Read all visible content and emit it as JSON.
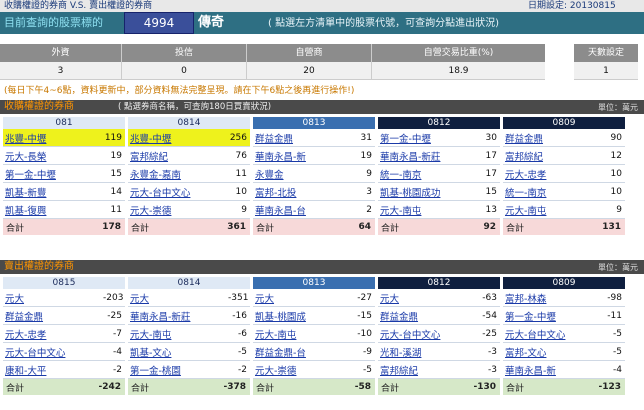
{
  "banner": {
    "title": "收購權證的券商 V.S. 賣出權證的券商",
    "date": "日期設定: 20130815"
  },
  "query": {
    "label": "目前查詢的股票標的",
    "code": "4994",
    "name": "傳奇",
    "hint": "( 點選左方清單中的股票代號，可查詢分點進出狀況)"
  },
  "summary": {
    "headers": [
      "外資",
      "投信",
      "自營商",
      "自營交易比重(%)"
    ],
    "values": [
      "3",
      "0",
      "20",
      "18.9"
    ],
    "days_label": "天數設定",
    "days_value": "1"
  },
  "note": "(每日下午4~6點，資料更新中，部分資料無法完整呈現。請在下午6點之後再進行操作!)",
  "buy": {
    "title": "收購權證的券商",
    "hint": "( 點選券商名稱，可查詢180日買賣狀況)",
    "unit": "單位：萬元",
    "columns": [
      {
        "date": "081",
        "total_label": "合計",
        "total": "178",
        "rows": [
          {
            "name": "兆豐-中壢",
            "value": "119"
          },
          {
            "name": "元大-長榮",
            "value": "19"
          },
          {
            "name": "第一金-中壢",
            "value": "15"
          },
          {
            "name": "凱基-新豐",
            "value": "14"
          },
          {
            "name": "凱基-復興",
            "value": "11"
          }
        ]
      },
      {
        "date": "0814",
        "total_label": "合計",
        "total": "361",
        "rows": [
          {
            "name": "兆豐-中壢",
            "value": "256"
          },
          {
            "name": "富邦綜紀",
            "value": "76"
          },
          {
            "name": "永豐金-嘉南",
            "value": "11"
          },
          {
            "name": "元大-台中文心",
            "value": "10"
          },
          {
            "name": "元大-崇德",
            "value": "9"
          }
        ]
      },
      {
        "date": "0813",
        "total_label": "合計",
        "total": "64",
        "rows": [
          {
            "name": "群益金鼎",
            "value": "31"
          },
          {
            "name": "華南永昌-新",
            "value": "19"
          },
          {
            "name": "永豐金",
            "value": "9"
          },
          {
            "name": "富邦-北投",
            "value": "3"
          },
          {
            "name": "華南永昌-台",
            "value": "2"
          }
        ]
      },
      {
        "date": "0812",
        "total_label": "合計",
        "total": "92",
        "rows": [
          {
            "name": "第一金-中壢",
            "value": "30"
          },
          {
            "name": "華南永昌-新莊",
            "value": "17"
          },
          {
            "name": "統一-南京",
            "value": "17"
          },
          {
            "name": "凱基-桃園成功",
            "value": "15"
          },
          {
            "name": "元大-南屯",
            "value": "13"
          }
        ]
      },
      {
        "date": "0809",
        "total_label": "合計",
        "total": "131",
        "rows": [
          {
            "name": "群益金鼎",
            "value": "90"
          },
          {
            "name": "富邦綜紀",
            "value": "12"
          },
          {
            "name": "元大-忠孝",
            "value": "10"
          },
          {
            "name": "統一-南京",
            "value": "10"
          },
          {
            "name": "元大-南屯",
            "value": "9"
          }
        ]
      }
    ]
  },
  "sell": {
    "title": "賣出權證的券商",
    "unit": "單位：萬元",
    "columns": [
      {
        "date": "0815",
        "total_label": "合計",
        "total": "-242",
        "rows": [
          {
            "name": "元大",
            "value": "-203"
          },
          {
            "name": "群益金鼎",
            "value": "-25"
          },
          {
            "name": "元大-忠孝",
            "value": "-7"
          },
          {
            "name": "元大-台中文心",
            "value": "-4"
          },
          {
            "name": "康和-大平",
            "value": "-2"
          }
        ]
      },
      {
        "date": "0814",
        "total_label": "合計",
        "total": "-378",
        "rows": [
          {
            "name": "元大",
            "value": "-351"
          },
          {
            "name": "華南永昌-新莊",
            "value": "-16"
          },
          {
            "name": "元大-南屯",
            "value": "-6"
          },
          {
            "name": "凱基-文心",
            "value": "-5"
          },
          {
            "name": "第一金-桃園",
            "value": "-2"
          }
        ]
      },
      {
        "date": "0813",
        "total_label": "合計",
        "total": "-58",
        "rows": [
          {
            "name": "元大",
            "value": "-27"
          },
          {
            "name": "凱基-桃園成",
            "value": "-15"
          },
          {
            "name": "元大-南屯",
            "value": "-10"
          },
          {
            "name": "群益金鼎-台",
            "value": "-9"
          },
          {
            "name": "元大-崇德",
            "value": "-5"
          }
        ]
      },
      {
        "date": "0812",
        "total_label": "合計",
        "total": "-130",
        "rows": [
          {
            "name": "元大",
            "value": "-63"
          },
          {
            "name": "群益金鼎",
            "value": "-54"
          },
          {
            "name": "元大-台中文心",
            "value": "-25"
          },
          {
            "name": "光和-溪湖",
            "value": "-3"
          },
          {
            "name": "富邦綜紀",
            "value": "-3"
          }
        ]
      },
      {
        "date": "0809",
        "total_label": "合計",
        "total": "-123",
        "rows": [
          {
            "name": "富邦-林森",
            "value": "-98"
          },
          {
            "name": "第一金-中壢",
            "value": "-11"
          },
          {
            "name": "元大-台中文心",
            "value": "-5"
          },
          {
            "name": "富邦-文心",
            "value": "-5"
          },
          {
            "name": "華南永昌-新",
            "value": "-4"
          }
        ]
      }
    ]
  },
  "colors": {
    "head_dark": "#0f1f3f",
    "head_mid": "#3a6fb0",
    "head_light": "#7fb0e0",
    "highlight": "#eef21c"
  }
}
